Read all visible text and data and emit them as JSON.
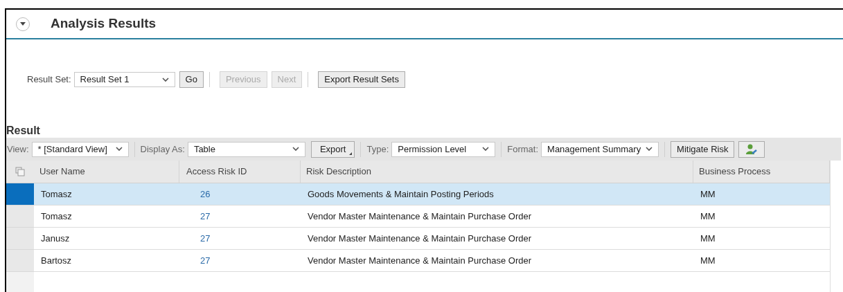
{
  "panel": {
    "title": "Analysis Results",
    "expanded": true
  },
  "result_set": {
    "label": "Result Set:",
    "value": "Result Set 1",
    "buttons": [
      {
        "label": "Go",
        "disabled": false
      },
      {
        "label": "Previous",
        "disabled": true
      },
      {
        "label": "Next",
        "disabled": true
      },
      {
        "label": "Export Result Sets",
        "disabled": false
      }
    ]
  },
  "result": {
    "title": "Result",
    "toolbar": [
      {
        "kind": "select",
        "label": "View:",
        "value": "* [Standard View]"
      },
      {
        "kind": "select",
        "label": "Display As:",
        "value": "Table"
      },
      {
        "kind": "menu-button",
        "label": "Export"
      },
      {
        "kind": "select",
        "label": "Type:",
        "value": "Permission Level"
      },
      {
        "kind": "select",
        "label": "Format:",
        "value": "Management Summary"
      },
      {
        "kind": "button",
        "label": "Mitigate Risk"
      },
      {
        "kind": "icon-button"
      }
    ],
    "table": {
      "columns": [
        "User Name",
        "Access Risk ID",
        "Risk Description",
        "Business Process"
      ],
      "rows": [
        {
          "selected": true,
          "cells": [
            "Tomasz",
            "26",
            "Goods Movements & Maintain Posting Periods",
            "MM"
          ]
        },
        {
          "selected": false,
          "cells": [
            "Tomasz",
            "27",
            "Vendor Master Maintenance & Maintain Purchase Order",
            "MM"
          ]
        },
        {
          "selected": false,
          "cells": [
            "Janusz",
            "27",
            "Vendor Master Maintenance & Maintain Purchase Order",
            "MM"
          ]
        },
        {
          "selected": false,
          "cells": [
            "Bartosz",
            "27",
            "Vendor Master Maintenance & Maintain Purchase Order",
            "MM"
          ]
        }
      ]
    }
  }
}
